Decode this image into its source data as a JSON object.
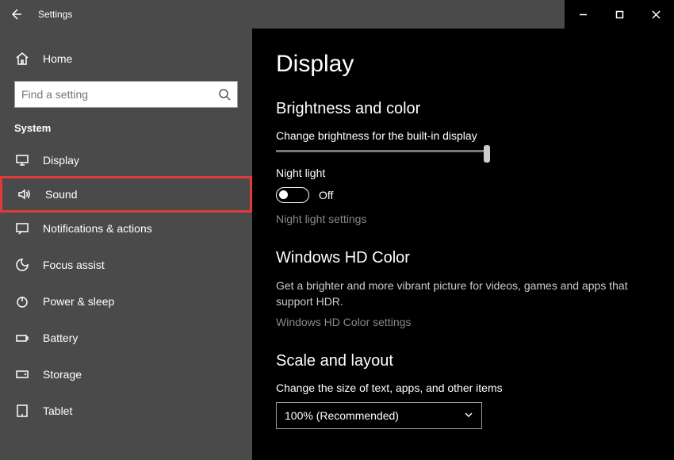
{
  "titlebar": {
    "back": "back",
    "title": "Settings"
  },
  "sidebar": {
    "home": "Home",
    "search_placeholder": "Find a setting",
    "section": "System",
    "items": [
      {
        "icon": "display",
        "label": "Display",
        "highlighted": false
      },
      {
        "icon": "sound",
        "label": "Sound",
        "highlighted": true
      },
      {
        "icon": "notif",
        "label": "Notifications & actions",
        "highlighted": false
      },
      {
        "icon": "focus",
        "label": "Focus assist",
        "highlighted": false
      },
      {
        "icon": "power",
        "label": "Power & sleep",
        "highlighted": false
      },
      {
        "icon": "battery",
        "label": "Battery",
        "highlighted": false
      },
      {
        "icon": "storage",
        "label": "Storage",
        "highlighted": false
      },
      {
        "icon": "tablet",
        "label": "Tablet",
        "highlighted": false
      }
    ]
  },
  "content": {
    "page_title": "Display",
    "brightness": {
      "title": "Brightness and color",
      "slider_label": "Change brightness for the built-in display",
      "slider_value": 100,
      "night_light_label": "Night light",
      "night_light_state": "Off",
      "night_light_settings": "Night light settings"
    },
    "hdr": {
      "title": "Windows HD Color",
      "desc": "Get a brighter and more vibrant picture for videos, games and apps that support HDR.",
      "settings": "Windows HD Color settings"
    },
    "scale": {
      "title": "Scale and layout",
      "label": "Change the size of text, apps, and other items",
      "value": "100% (Recommended)"
    }
  }
}
